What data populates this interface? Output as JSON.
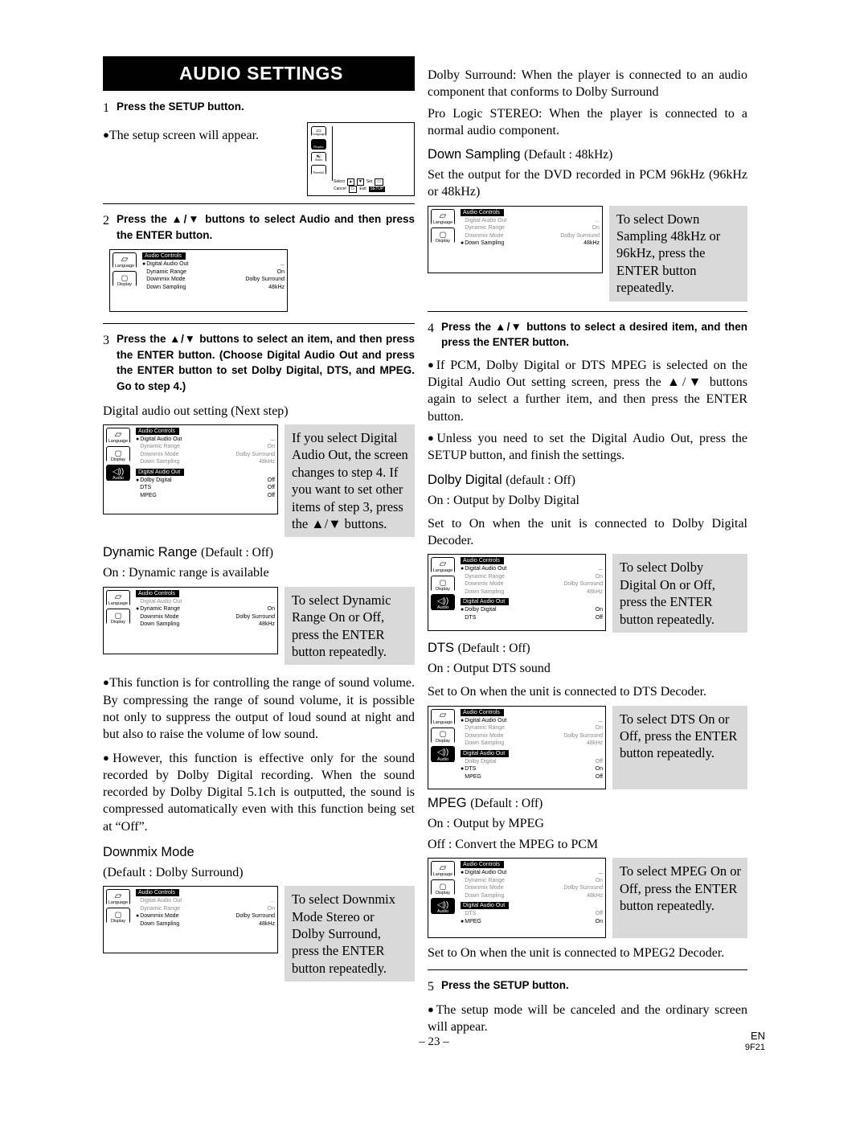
{
  "page": {
    "title": "AUDIO SETTINGS",
    "page_number": "– 23 –",
    "footer_code": "EN",
    "footer_sub": "9F21"
  },
  "left": {
    "step1": {
      "num": "1",
      "text": "Press the SETUP button."
    },
    "step1_bullet": "The setup screen will appear.",
    "step2": {
      "num": "2",
      "text": "Press the ▲/▼ buttons to select Audio and then press the ENTER button."
    },
    "step3": {
      "num": "3",
      "text": "Press the ▲/▼ buttons to select an item, and then press the ENTER button. (Choose Digital Audio Out and press the ENTER button to set Dolby Digital, DTS, and MPEG. Go to step 4.)"
    },
    "digital_audio_note": "Digital audio out setting (Next step)",
    "callout_step4": "If you select Digital Audio Out, the screen changes to step 4. If you want to set other items of step 3, press the ▲/▼ buttons.",
    "dynamic_range": {
      "head": "Dynamic Range",
      "sub": "(Default : Off)",
      "on_line": "On : Dynamic range is available",
      "callout": "To select Dynamic Range On or Off, press the ENTER button repeatedly."
    },
    "para_control": "This function is for controlling the range of sound volume.  By compressing the range of sound volume, it is possible not only to suppress the output of loud sound at night and but also to raise the volume of low sound.",
    "para_however": "However, this function is effective only for the sound recorded by Dolby Digital recording. When the sound recorded by Dolby Digital 5.1ch is outputted, the sound is compressed automatically even with this function being set at “Off”.",
    "downmix": {
      "head": "Downmix Mode",
      "sub": "(Default : Dolby Surround)",
      "callout": "To select Downmix Mode Stereo or Dolby Surround, press the ENTER button repeatedly."
    }
  },
  "right": {
    "intro_dolby": "Dolby Surround: When the player is connected to an audio component that conforms to Dolby Surround",
    "intro_prologic": "Pro Logic STEREO: When the player is connected to a normal audio component.",
    "down_sampling": {
      "head": "Down Sampling",
      "sub": "(Default : 48kHz)",
      "body": "Set the output for the DVD recorded in PCM 96kHz (96kHz or 48kHz)",
      "callout": "To select Down Sampling 48kHz or 96kHz, press the ENTER button repeatedly."
    },
    "step4": {
      "num": "4",
      "text": "Press the ▲/▼ buttons to select a desired item, and then press the ENTER button."
    },
    "bullet_pcm": "If PCM, Dolby Digital or DTS MPEG is selected on the Digital Audio Out setting screen, press the ▲/▼ buttons again to select a further item, and then press the ENTER button.",
    "bullet_unless": "Unless you need to set the Digital Audio Out, press the SETUP button, and finish the settings.",
    "dolby_digital": {
      "head": "Dolby Digital",
      "sub": "(default : Off)",
      "on_line": "On : Output by Dolby Digital",
      "body": "Set to On when the unit is connected to Dolby Digital Decoder.",
      "callout": "To select Dolby Digital On or Off, press the ENTER button repeatedly."
    },
    "dts": {
      "head": "DTS",
      "sub": "(Default : Off)",
      "on_line": "On : Output DTS sound",
      "body": "Set to On when the unit is connected to DTS Decoder.",
      "callout": "To select DTS On or Off, press the ENTER button repeatedly."
    },
    "mpeg": {
      "head": "MPEG",
      "sub": "(Default : Off)",
      "on_line": "On : Output by MPEG",
      "off_line": "Off : Convert the MPEG to PCM",
      "callout": "To select MPEG On or Off, press the ENTER button repeatedly.",
      "body": "Set to On when the unit is connected to MPEG2 Decoder."
    },
    "step5": {
      "num": "5",
      "text": "Press the SETUP button."
    },
    "bullet_cancel": "The setup mode will be canceled and the ordinary screen will appear."
  },
  "osd": {
    "sidebar": {
      "language": "Language",
      "display": "Display",
      "audio": "Audio",
      "parental": "Parental"
    },
    "panel_title_audio": "Audio Controls",
    "panel_title_dao": "Digital Audio Out",
    "items": {
      "digital_audio_out": {
        "name": "Digital Audio Out",
        "value": "..."
      },
      "dynamic_range": {
        "name": "Dynamic Range",
        "value": "On"
      },
      "downmix_mode": {
        "name": "Downmix Mode",
        "value": "Dolby Surround"
      },
      "down_sampling": {
        "name": "Down Sampling",
        "value": "48kHz"
      },
      "dolby_digital": {
        "name": "Dolby Digital",
        "value": "Off"
      },
      "dts": {
        "name": "DTS",
        "value": "Off"
      },
      "mpeg": {
        "name": "MPEG",
        "value": "Off"
      },
      "dts_on": {
        "name": "DTS",
        "value": "On"
      },
      "mpeg_on": {
        "name": "MPEG",
        "value": "On"
      },
      "dolby_digital_on": {
        "name": "Dolby Digital",
        "value": "On"
      }
    }
  },
  "remote": {
    "select": "Select",
    "set": "Set",
    "cancel": "Cancel",
    "exit": "Exit",
    "enter": "ENTER",
    "setup": "SETUP"
  }
}
